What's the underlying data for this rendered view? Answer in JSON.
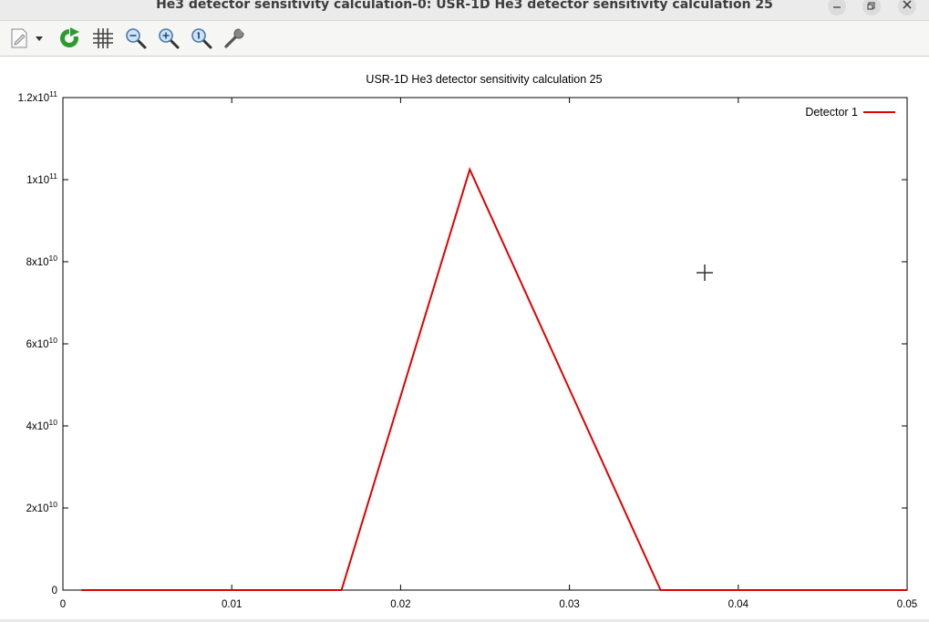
{
  "window": {
    "title": "He3 detector sensitivity calculation-0: USR-1D He3 detector sensitivity calculation 25"
  },
  "toolbar": {
    "tools": [
      "export-icon",
      "dropdown-arrow-icon",
      "refresh-icon",
      "grid-icon",
      "zoom-out-icon",
      "zoom-in-icon",
      "zoom-reset-icon",
      "settings-wrench-icon"
    ]
  },
  "chart_data": {
    "type": "line",
    "title": "USR-1D He3 detector sensitivity calculation 25",
    "xlabel": "",
    "ylabel": "",
    "xlim": [
      0,
      0.05
    ],
    "ylim": [
      0,
      120000000000
    ],
    "x_ticks": [
      {
        "value": 0,
        "label": "0"
      },
      {
        "value": 0.01,
        "label": "0.01"
      },
      {
        "value": 0.02,
        "label": "0.02"
      },
      {
        "value": 0.03,
        "label": "0.03"
      },
      {
        "value": 0.04,
        "label": "0.04"
      },
      {
        "value": 0.05,
        "label": "0.05"
      }
    ],
    "y_ticks": [
      {
        "value": 0,
        "label": "0",
        "mant": "0",
        "exp": ""
      },
      {
        "value": 20000000000,
        "label": "2x10^10",
        "mant": "2x10",
        "exp": "10"
      },
      {
        "value": 40000000000,
        "label": "4x10^10",
        "mant": "4x10",
        "exp": "10"
      },
      {
        "value": 60000000000,
        "label": "6x10^10",
        "mant": "6x10",
        "exp": "10"
      },
      {
        "value": 80000000000,
        "label": "8x10^10",
        "mant": "8x10",
        "exp": "10"
      },
      {
        "value": 100000000000,
        "label": "1x10^11",
        "mant": "1x10",
        "exp": "11"
      },
      {
        "value": 120000000000,
        "label": "1.2x10^11",
        "mant": "1.2x10",
        "exp": "11"
      }
    ],
    "grid": false,
    "legend": "top-right",
    "series": [
      {
        "name": "Detector 1",
        "color": "#e00000",
        "x": [
          0.0011,
          0.0165,
          0.0241,
          0.0354,
          0.05
        ],
        "y": [
          0,
          0,
          102500000000,
          0,
          0
        ]
      }
    ]
  }
}
